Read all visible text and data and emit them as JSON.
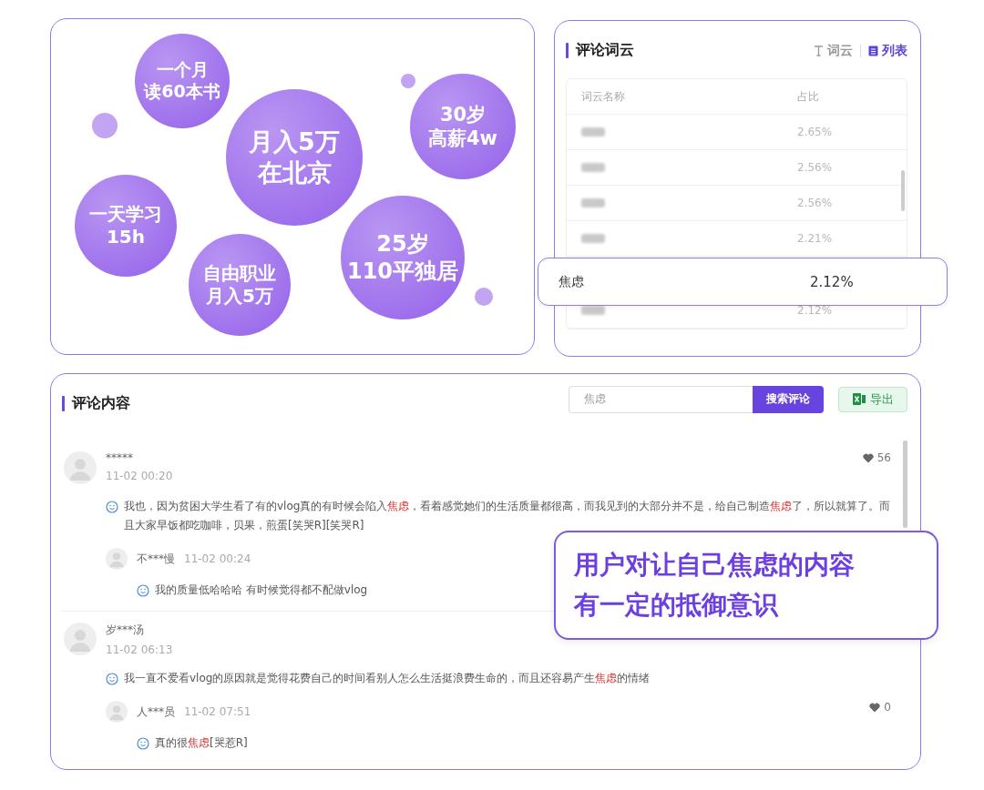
{
  "bubbles": [
    {
      "lines": [
        "一个月",
        "读60本书"
      ]
    },
    {
      "lines": [
        "月入5万",
        "在北京"
      ]
    },
    {
      "lines": [
        "30岁",
        "高薪4w"
      ]
    },
    {
      "lines": [
        "一天学习",
        "15h"
      ]
    },
    {
      "lines": [
        "自由职业",
        "月入5万"
      ]
    },
    {
      "lines": [
        "25岁",
        "110平独居"
      ]
    }
  ],
  "word_cloud": {
    "title": "评论词云",
    "views": [
      {
        "label": "词云",
        "kind": "cloud",
        "selected": false
      },
      {
        "label": "列表",
        "kind": "list",
        "selected": true
      }
    ],
    "columns": [
      "词云名称",
      "占比"
    ],
    "rows": [
      {
        "share": "2.65%"
      },
      {
        "share": "2.56%"
      },
      {
        "share": "2.56%"
      },
      {
        "share": "2.21%"
      },
      {
        "share": "2.12%"
      }
    ],
    "highlight_row": {
      "word": "焦虑",
      "share": "2.12%"
    }
  },
  "comments_panel": {
    "title": "评论内容",
    "search": {
      "value": "焦虑",
      "button": "搜索评论"
    },
    "export": "导出",
    "comments": [
      {
        "user": "*****",
        "time": "11-02 00:20",
        "likes": "56",
        "text": [
          {
            "t": "我也，因为贫困大学生看了有的vlog真的有时候会陷入",
            "hl": false
          },
          {
            "t": "焦虑",
            "hl": true
          },
          {
            "t": "，看着感觉她们的生活质量都很高，而我见到的大部分并不是，给自己制造",
            "hl": false
          },
          {
            "t": "焦虑",
            "hl": true
          },
          {
            "t": "了，所以就算了。而且大家早饭都吃咖啡，贝果，煎蛋[笑哭R][笑哭R]",
            "hl": false
          }
        ],
        "replies": [
          {
            "user": "不***慢",
            "time": "11-02 00:24",
            "text": [
              {
                "t": "我的质量低哈哈哈 有时候觉得都不配做vlog",
                "hl": false
              }
            ]
          }
        ]
      },
      {
        "user": "岁***汤",
        "time": "11-02 06:13",
        "text": [
          {
            "t": "我一直不爱看vlog的原因就是觉得花费自己的时间看别人怎么生活挺浪费生命的，而且还容易产生",
            "hl": false
          },
          {
            "t": "焦虑",
            "hl": true
          },
          {
            "t": "的情绪",
            "hl": false
          }
        ],
        "replies": [
          {
            "user": "人***员",
            "time": "11-02 07:51",
            "likes": "0",
            "text": [
              {
                "t": "真的很",
                "hl": false
              },
              {
                "t": "焦虑",
                "hl": true
              },
              {
                "t": "[哭惹R]",
                "hl": false
              }
            ]
          }
        ]
      }
    ]
  },
  "callout": {
    "lines": [
      "用户对让自己焦虑的内容",
      "有一定的抵御意识"
    ]
  }
}
